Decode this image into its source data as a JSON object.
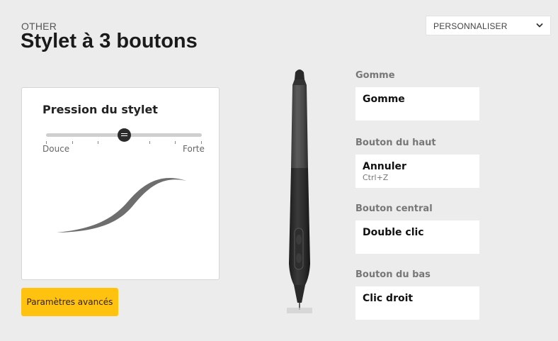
{
  "header": {
    "category": "OTHER",
    "title": "Stylet à 3 boutons"
  },
  "profile_dropdown": {
    "selected": "PERSONNALISER",
    "icon": "chevron-down-icon"
  },
  "pressure": {
    "title": "Pression du stylet",
    "min_label": "Douce",
    "max_label": "Forte",
    "level": 0.5,
    "stroke_color": "#6e6e6e"
  },
  "advanced_button": {
    "label": "Paramètres avancés",
    "color": "#ffc20e"
  },
  "pen_buttons": [
    {
      "section": "Gomme",
      "value": "Gomme",
      "shortcut": ""
    },
    {
      "section": "Bouton du haut",
      "value": "Annuler",
      "shortcut": "Ctrl+Z"
    },
    {
      "section": "Bouton central",
      "value": "Double clic",
      "shortcut": ""
    },
    {
      "section": "Bouton du bas",
      "value": "Clic droit",
      "shortcut": ""
    }
  ]
}
